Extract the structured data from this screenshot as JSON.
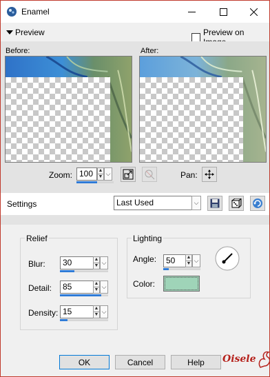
{
  "window": {
    "title": "Enamel",
    "app_icon": "paint-app-icon",
    "controls": [
      "minimize-icon",
      "maximize-icon",
      "close-icon"
    ]
  },
  "preview_header": {
    "toggle_label": "Preview",
    "preview_on_image_label": "Preview on Image",
    "preview_on_image_checked": false
  },
  "preview": {
    "before_label": "Before:",
    "after_label": "After:",
    "zoom_label": "Zoom:",
    "zoom_value": "100",
    "pan_label": "Pan:"
  },
  "settings": {
    "label": "Settings",
    "preset_value": "Last Used",
    "icons": [
      "save-preset-icon",
      "randomize-dice-icon",
      "reset-icon"
    ]
  },
  "relief": {
    "title": "Relief",
    "blur_label": "Blur:",
    "blur_value": "30",
    "blur_level": 0.3,
    "detail_label": "Detail:",
    "detail_value": "85",
    "detail_level": 0.85,
    "density_label": "Density:",
    "density_value": "15",
    "density_level": 0.15
  },
  "lighting": {
    "title": "Lighting",
    "angle_label": "Angle:",
    "angle_value": "50",
    "angle_level": 0.14,
    "color_label": "Color:",
    "color_hex": "#9fd4b8"
  },
  "buttons": {
    "ok": "OK",
    "cancel": "Cancel",
    "help": "Help"
  },
  "watermark": {
    "text": "Oisele"
  }
}
